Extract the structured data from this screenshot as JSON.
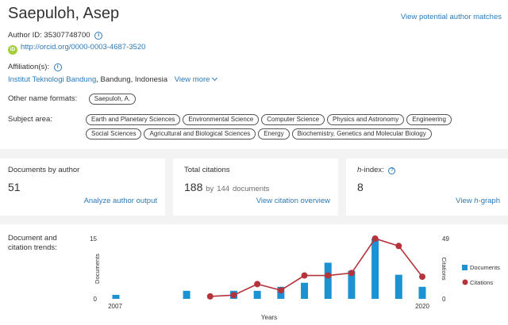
{
  "author": {
    "name": "Saepuloh, Asep",
    "view_potential_label": "View potential author matches",
    "author_id_label": "Author ID: 35307748700",
    "orcid_badge": "iD",
    "orcid_url": "http://orcid.org/0000-0003-4687-3520",
    "affiliation_label": "Affiliation(s):",
    "affiliation_name": "Institut Teknologi Bandung",
    "affiliation_location": ", Bandung, Indonesia",
    "view_more_label": "View more",
    "other_names_label": "Other name formats:",
    "other_names": [
      "Saepuloh, A."
    ],
    "subject_area_label": "Subject area:",
    "subject_areas": [
      "Earth and Planetary Sciences",
      "Environmental Science",
      "Computer Science",
      "Physics and Astronomy",
      "Engineering",
      "Social Sciences",
      "Agricultural and Biological Sciences",
      "Energy",
      "Biochemistry, Genetics and Molecular Biology"
    ]
  },
  "metrics": {
    "documents": {
      "label": "Documents by author",
      "value": "51",
      "action": "Analyze author output"
    },
    "citations": {
      "label": "Total citations",
      "value": "188",
      "by_text": "by",
      "doc_count": "144",
      "doc_suffix": "documents",
      "action": "View citation overview"
    },
    "hindex": {
      "label_prefix": "h",
      "label_suffix": "-index:",
      "value": "8",
      "action_prefix": "View ",
      "action_italic": "h",
      "action_suffix": "-graph"
    }
  },
  "colors": {
    "link": "#2b7ab8",
    "documents_bar": "#1b92d1",
    "citations_line": "#b5333a"
  },
  "chart_label": [
    "Document and",
    "citation trends:"
  ],
  "chart_data": {
    "type": "bar",
    "title": "",
    "xlabel": "Years",
    "ylabel_left": "Documents",
    "ylabel_right": "Citations",
    "x_tick_labels": [
      "2007",
      "2020"
    ],
    "ylim_left": [
      0,
      15
    ],
    "ylim_right": [
      0,
      49
    ],
    "left_tick_labels": [
      "15",
      "0"
    ],
    "right_tick_labels": [
      "49",
      "0"
    ],
    "legend_position": "right",
    "series": [
      {
        "name": "Documents",
        "type": "bar",
        "x": [
          2007,
          2010,
          2012,
          2013,
          2014,
          2015,
          2016,
          2017,
          2018,
          2019,
          2020
        ],
        "values": [
          1,
          2,
          2,
          2,
          3,
          4,
          9,
          7,
          15,
          6,
          3
        ]
      },
      {
        "name": "Citations",
        "type": "line",
        "x": [
          2011,
          2012,
          2013,
          2014,
          2015,
          2016,
          2017,
          2018,
          2019,
          2020
        ],
        "values": [
          2,
          3,
          12,
          7,
          19,
          19,
          21,
          49,
          43,
          18
        ]
      }
    ]
  }
}
